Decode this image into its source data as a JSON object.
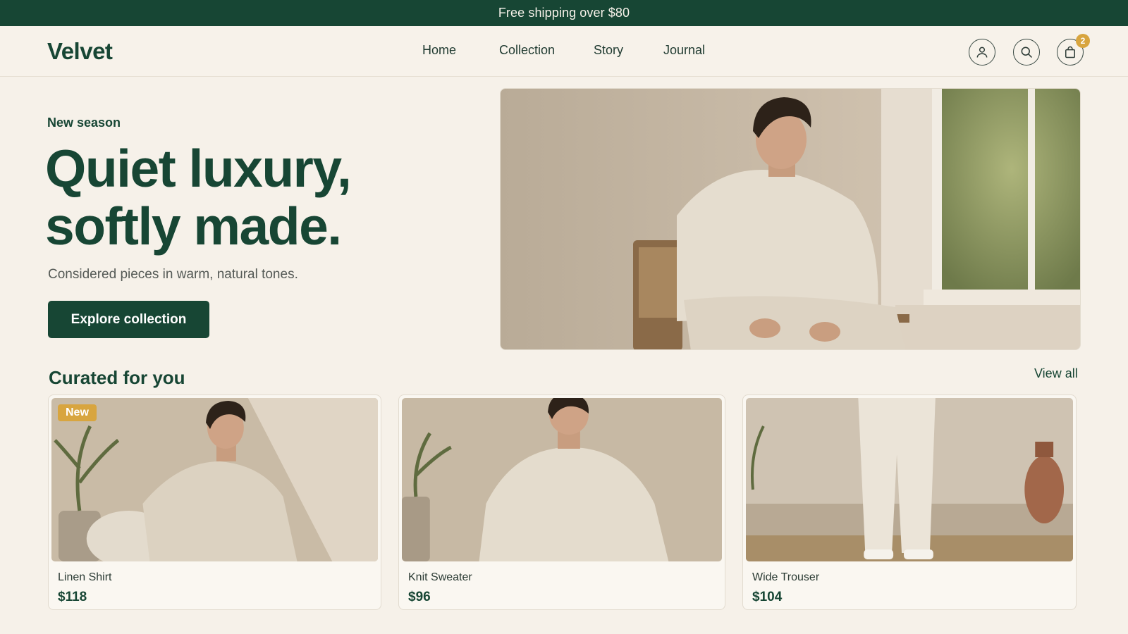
{
  "announcement": "Free shipping over $80",
  "brand": "Velvet",
  "nav": [
    {
      "label": "Home"
    },
    {
      "label": "Collection"
    },
    {
      "label": "Story"
    },
    {
      "label": "Journal"
    }
  ],
  "header_icons": [
    "user-icon",
    "search-icon",
    "bag-icon"
  ],
  "cart_count": "2",
  "hero": {
    "eyebrow": "New season",
    "headline_line1": "Quiet luxury,",
    "headline_line2": "softly made.",
    "subtext": "Considered pieces in warm, natural tones.",
    "cta": "Explore collection"
  },
  "curated": {
    "title": "Curated for you",
    "view_all": "View all",
    "products": [
      {
        "name": "Linen Shirt",
        "price": "$118",
        "badge": "New"
      },
      {
        "name": "Knit Sweater",
        "price": "$96"
      },
      {
        "name": "Wide Trouser",
        "price": "$104"
      }
    ]
  },
  "colors": {
    "primary": "#174634",
    "accent": "#d8a53f",
    "background": "#f6f1e9"
  }
}
